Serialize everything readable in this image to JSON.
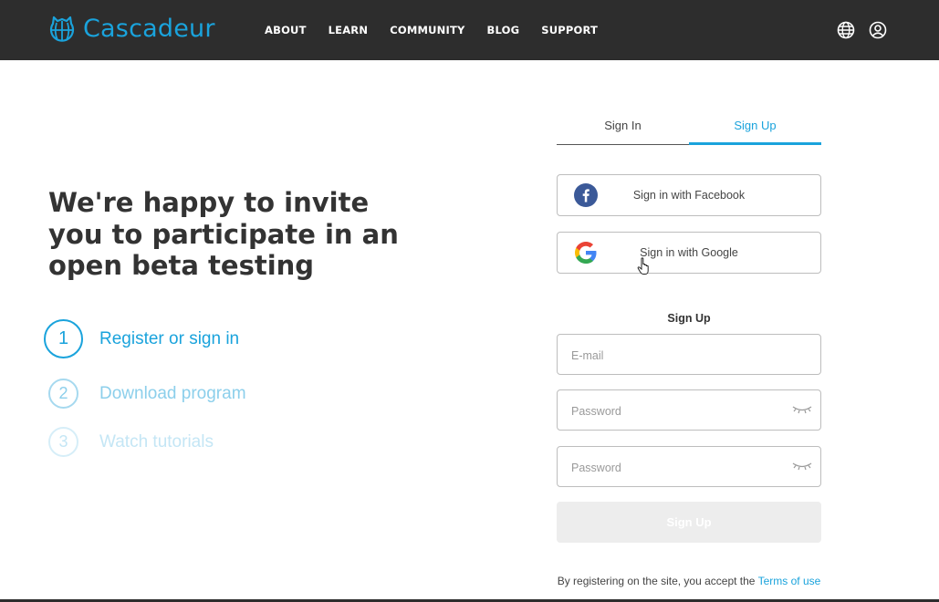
{
  "header": {
    "brand": "Cascadeur",
    "nav": [
      "ABOUT",
      "LEARN",
      "COMMUNITY",
      "BLOG",
      "SUPPORT"
    ]
  },
  "hero": {
    "heading": "We're happy to invite you to participate in an open beta testing",
    "steps": [
      {
        "number": "1",
        "label": "Register or sign in"
      },
      {
        "number": "2",
        "label": "Download program"
      },
      {
        "number": "3",
        "label": "Watch tutorials"
      }
    ]
  },
  "auth": {
    "tabs": {
      "sign_in": "Sign In",
      "sign_up": "Sign Up"
    },
    "facebook_label": "Sign in with Facebook",
    "google_label": "Sign in with Google",
    "form_title": "Sign Up",
    "email_placeholder": "E-mail",
    "password_placeholder": "Password",
    "password_confirm_placeholder": "Password",
    "submit_label": "Sign Up",
    "terms_prefix": "By registering on the site, you accept the",
    "terms_link": "Terms of use"
  },
  "colors": {
    "accent": "#1aa3dc",
    "header_bg": "#2d2d2d",
    "facebook": "#3b5998"
  }
}
